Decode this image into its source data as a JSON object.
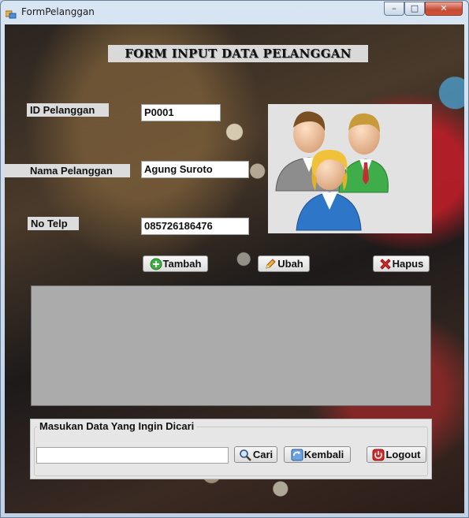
{
  "window": {
    "title": "FormPelanggan",
    "controls": {
      "minimize": "–",
      "maximize": "□",
      "close": "✕"
    }
  },
  "form": {
    "heading": "FORM INPUT DATA PELANGGAN",
    "fields": {
      "id": {
        "label": "ID Pelanggan",
        "value": "P0001"
      },
      "nama": {
        "label": "Nama Pelanggan",
        "value": "Agung Suroto"
      },
      "telp": {
        "label": "No Telp",
        "value": "085726186476"
      }
    },
    "picture_icon": "users-group-icon",
    "buttons": {
      "tambah": "Tambah",
      "ubah": "Ubah",
      "hapus": "Hapus"
    }
  },
  "grid": {
    "rows": []
  },
  "search": {
    "caption": "Masukan Data Yang Ingin Dicari",
    "value": "",
    "buttons": {
      "cari": "Cari",
      "kembali": "Kembali",
      "logout": "Logout"
    }
  },
  "colors": {
    "title_bar": "#c4d6ea",
    "grid_bg": "#ababab",
    "close_button": "#c74a32"
  }
}
